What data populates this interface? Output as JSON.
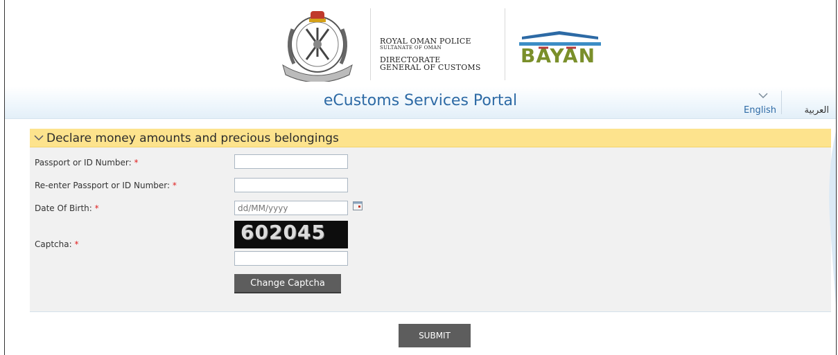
{
  "header": {
    "org_line1": "ROYAL OMAN POLICE",
    "org_line2": "SULTANATE OF OMAN",
    "org_line3": "DIRECTORATE",
    "org_line4": "GENERAL OF CUSTOMS",
    "logo_text": "BAYAN"
  },
  "titlebar": {
    "portal_title": "eCustoms Services Portal",
    "lang_english": "English",
    "lang_arabic": "العربية"
  },
  "form": {
    "section_title": "Declare money amounts and precious belongings",
    "passport_label": "Passport or ID Number:",
    "reenter_label": "Re-enter Passport or ID Number:",
    "dob_label": "Date Of Birth:",
    "dob_placeholder": "dd/MM/yyyy",
    "captcha_label": "Captcha:",
    "captcha_code": "602045",
    "required_mark": "*",
    "change_captcha_label": "Change Captcha",
    "submit_label": "SUBMIT"
  },
  "colors": {
    "accent_blue": "#2d6aa5",
    "section_header": "#fde38d",
    "button_gray": "#5d5d5d",
    "required_red": "#e02020"
  }
}
